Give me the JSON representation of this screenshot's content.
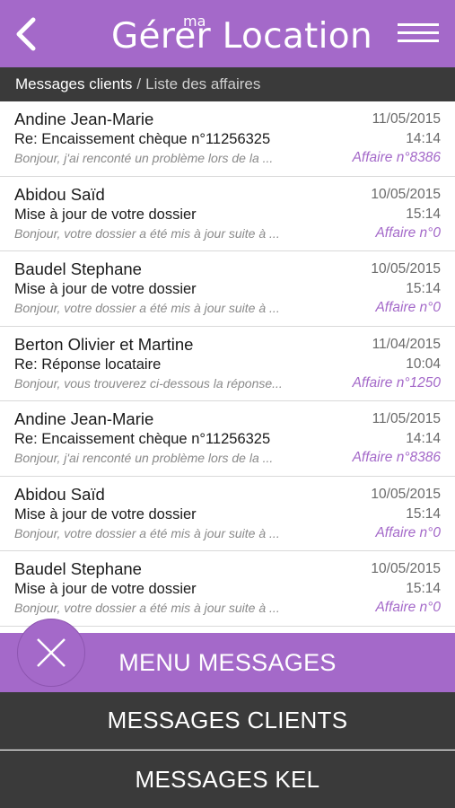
{
  "header": {
    "logo_main": "Gérer Location",
    "logo_small": "ma",
    "back_icon": "chevron-left-icon",
    "menu_icon": "hamburger-menu-icon"
  },
  "breadcrumb": {
    "current": "Messages clients",
    "separator": "/",
    "link": "Liste des affaires"
  },
  "messages": [
    {
      "name": "Andine Jean-Marie",
      "subject": "Re: Encaissement chèque n°11256325",
      "preview": "Bonjour, j'ai renconté un problème lors de la ...",
      "date": "11/05/2015",
      "time": "14:14",
      "affaire": "Affaire n°8386"
    },
    {
      "name": "Abidou Saïd",
      "subject": "Mise à jour de votre dossier",
      "preview": "Bonjour, votre dossier a été mis à jour suite à ...",
      "date": "10/05/2015",
      "time": "15:14",
      "affaire": "Affaire n°0"
    },
    {
      "name": "Baudel Stephane",
      "subject": "Mise à jour de votre dossier",
      "preview": "Bonjour, votre dossier a été mis à jour suite à ...",
      "date": "10/05/2015",
      "time": "15:14",
      "affaire": "Affaire n°0"
    },
    {
      "name": "Berton Olivier et Martine",
      "subject": "Re: Réponse locataire",
      "preview": "Bonjour, vous trouverez ci-dessous la réponse...",
      "date": "11/04/2015",
      "time": "10:04",
      "affaire": "Affaire n°1250"
    },
    {
      "name": "Andine Jean-Marie",
      "subject": "Re: Encaissement chèque n°11256325",
      "preview": "Bonjour, j'ai renconté un problème lors de la ...",
      "date": "11/05/2015",
      "time": "14:14",
      "affaire": "Affaire n°8386"
    },
    {
      "name": "Abidou Saïd",
      "subject": "Mise à jour de votre dossier",
      "preview": "Bonjour, votre dossier a été mis à jour suite à ...",
      "date": "10/05/2015",
      "time": "15:14",
      "affaire": "Affaire n°0"
    },
    {
      "name": "Baudel Stephane",
      "subject": "Mise à jour de votre dossier",
      "preview": "Bonjour, votre dossier a été mis à jour suite à ...",
      "date": "10/05/2015",
      "time": "15:14",
      "affaire": "Affaire n°0"
    }
  ],
  "bottom_menu": {
    "title": "MENU MESSAGES",
    "close_icon": "close-icon",
    "options": [
      "MESSAGES CLIENTS",
      "MESSAGES KEL"
    ]
  },
  "colors": {
    "accent": "#a469c9",
    "dark": "#3a3a3a"
  }
}
